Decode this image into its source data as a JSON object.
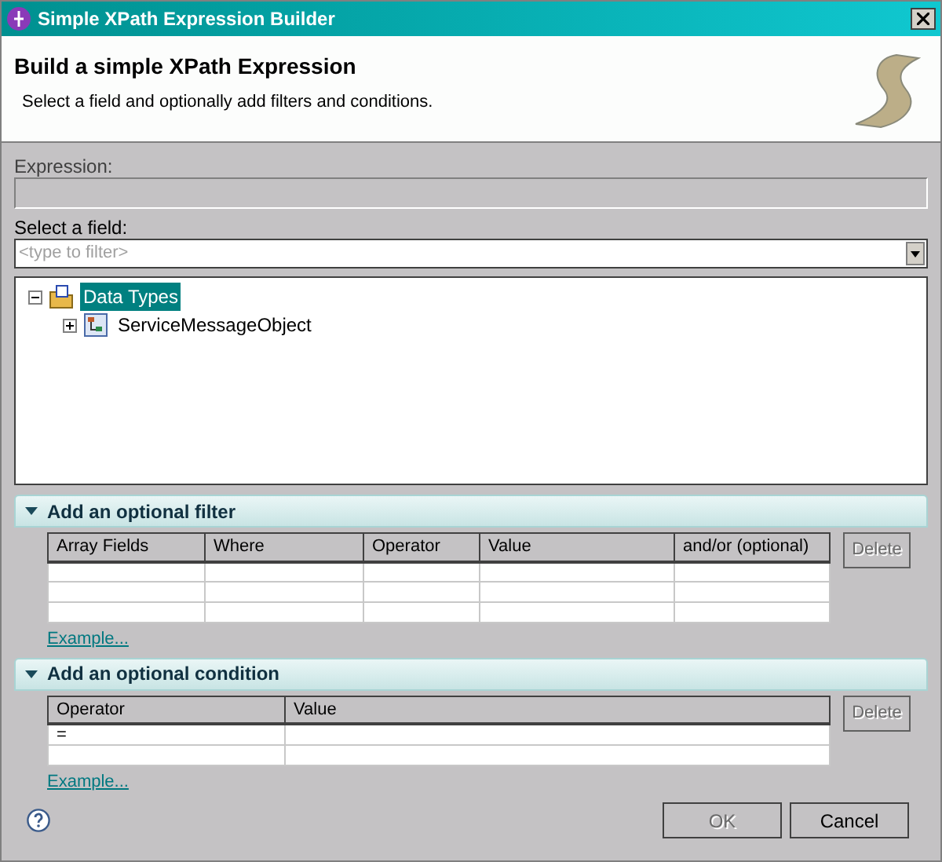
{
  "window": {
    "title": "Simple XPath Expression Builder"
  },
  "header": {
    "title": "Build a simple XPath Expression",
    "description": "Select a field and optionally add filters and conditions."
  },
  "expression": {
    "label": "Expression:"
  },
  "field_select": {
    "label": "Select a field:",
    "placeholder": "<type to filter>"
  },
  "tree": [
    {
      "label": "Data Types",
      "expanded": true,
      "selected": true,
      "kind": "folder",
      "children": [
        {
          "label": "ServiceMessageObject",
          "expanded": false,
          "selected": false,
          "kind": "object"
        }
      ]
    }
  ],
  "sections": [
    {
      "title": "Add an optional filter",
      "expanded": true,
      "columns": [
        "Array Fields",
        "Where",
        "Operator",
        "Value",
        "and/or (optional)"
      ],
      "delete": {
        "label": "Delete",
        "disabled": true
      },
      "link": "Example..."
    },
    {
      "title": "Add an optional condition",
      "expanded": true,
      "columns": [
        "Operator",
        "Value"
      ],
      "rows": [
        [
          "="
        ]
      ],
      "delete": {
        "label": "Delete",
        "disabled": true
      },
      "link": "Example..."
    }
  ],
  "buttons": [
    {
      "label": "OK",
      "disabled": true
    },
    {
      "label": "Cancel",
      "disabled": false
    }
  ]
}
